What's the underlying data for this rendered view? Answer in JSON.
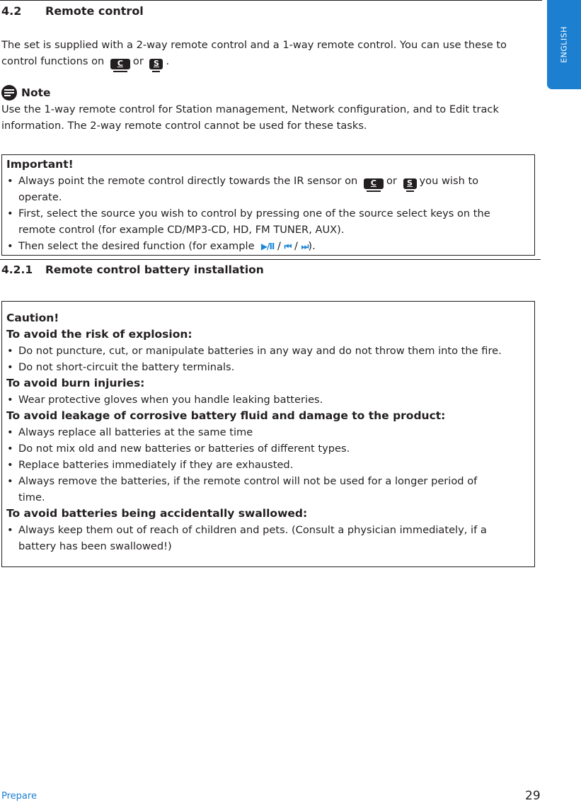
{
  "section": {
    "number": "4.2",
    "title": "Remote control",
    "intro_line1": "The set is supplied with a 2-way remote control and a 1-way remote control. You can use these to",
    "intro_line2_pre": "control functions on",
    "intro_line2_or": "or",
    "intro_line2_post": "."
  },
  "devices": {
    "center_label": "C",
    "station_label": "S"
  },
  "note": {
    "title": "Note",
    "line1": "Use the 1-way remote control for Station management, Network configuration, and to Edit track",
    "line2": "information. The 2-way remote control cannot be used for these tasks."
  },
  "important": {
    "title": "Important!",
    "bullet1_pre": "Always point the remote control directly towards the IR sensor on",
    "bullet1_or": "or",
    "bullet1_post": "you wish to",
    "bullet1_cont": "operate.",
    "bullet2_line1": "First, select the source you wish to control by pressing one of the source select keys on the",
    "bullet2_line2": "remote control (for example CD/MP3-CD, HD, FM TUNER, AUX).",
    "bullet3_pre": "Then select the desired function (for example",
    "bullet3_post": ").",
    "controls": {
      "play_pause": "▶/II",
      "sep": " / ",
      "previous": "⏮",
      "next": "⏭"
    }
  },
  "subsection": {
    "number": "4.2.1",
    "title": "Remote control battery installation"
  },
  "caution": {
    "title": "Caution!",
    "groups": [
      {
        "heading": "To avoid the risk of explosion:",
        "items": [
          "Do not puncture, cut, or manipulate batteries in any way and do not throw them into the fire.",
          "Do not short-circuit the battery terminals."
        ]
      },
      {
        "heading": "To avoid burn injuries:",
        "items": [
          "Wear protective gloves when you handle leaking batteries."
        ]
      },
      {
        "heading": "To avoid leakage of corrosive battery fluid and damage to the product:",
        "items": [
          "Always replace all batteries at the same time",
          "Do not mix old and new batteries or batteries of different types.",
          "Replace batteries immediately if they are exhausted.",
          "Always remove the batteries, if the remote control will not be used for a longer period of",
          "time."
        ]
      },
      {
        "heading": "To avoid batteries being accidentally swallowed:",
        "items": [
          "Always keep them out of reach of children and pets. (Consult a physician immediately, if a",
          "battery has been swallowed!)"
        ]
      }
    ]
  },
  "side_tab": {
    "label": "ENGLISH",
    "color": "#1c7fd0"
  },
  "footer": {
    "section": "Prepare",
    "page": "29"
  }
}
